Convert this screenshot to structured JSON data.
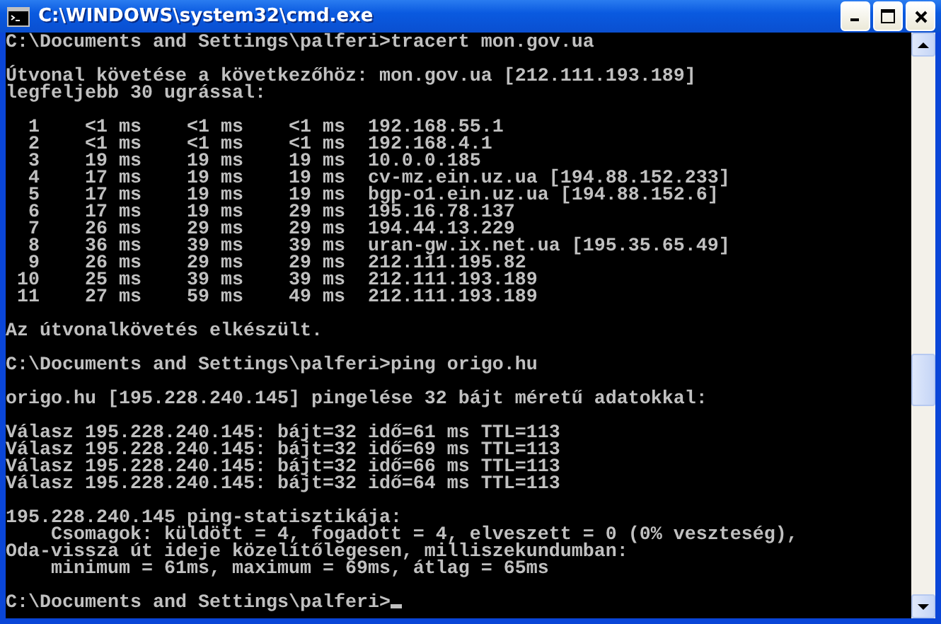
{
  "window": {
    "title": "C:\\WINDOWS\\system32\\cmd.exe"
  },
  "console": {
    "cursor": true,
    "blocks": [
      [
        "C:\\Documents and Settings\\palferi>tracert mon.gov.ua"
      ],
      [
        "Útvonal követése a következőhöz: mon.gov.ua [212.111.193.189]",
        "legfeljebb 30 ugrással:"
      ],
      [
        "  1    <1 ms    <1 ms    <1 ms  192.168.55.1",
        "  2    <1 ms    <1 ms    <1 ms  192.168.4.1",
        "  3    19 ms    19 ms    19 ms  10.0.0.185",
        "  4    17 ms    19 ms    19 ms  cv-mz.ein.uz.ua [194.88.152.233]",
        "  5    17 ms    19 ms    19 ms  bgp-o1.ein.uz.ua [194.88.152.6]",
        "  6    17 ms    19 ms    29 ms  195.16.78.137",
        "  7    26 ms    29 ms    29 ms  194.44.13.229",
        "  8    36 ms    39 ms    39 ms  uran-gw.ix.net.ua [195.35.65.49]",
        "  9    26 ms    29 ms    29 ms  212.111.195.82",
        " 10    25 ms    39 ms    39 ms  212.111.193.189",
        " 11    27 ms    59 ms    49 ms  212.111.193.189"
      ],
      [
        "Az útvonalkövetés elkészült."
      ],
      [
        "C:\\Documents and Settings\\palferi>ping origo.hu"
      ],
      [
        "origo.hu [195.228.240.145] pingelése 32 bájt méretű adatokkal:"
      ],
      [
        "Válasz 195.228.240.145: bájt=32 idő=61 ms TTL=113",
        "Válasz 195.228.240.145: bájt=32 idő=69 ms TTL=113",
        "Válasz 195.228.240.145: bájt=32 idő=66 ms TTL=113",
        "Válasz 195.228.240.145: bájt=32 idő=64 ms TTL=113"
      ],
      [
        "195.228.240.145 ping-statisztikája:",
        "    Csomagok: küldött = 4, fogadott = 4, elveszett = 0 (0% veszteség),",
        "Oda-vissza út ideje közelítőlegesen, milliszekundumban:",
        "    minimum = 61ms, maximum = 69ms, átlag = 65ms"
      ],
      [
        "C:\\Documents and Settings\\palferi>"
      ]
    ]
  }
}
